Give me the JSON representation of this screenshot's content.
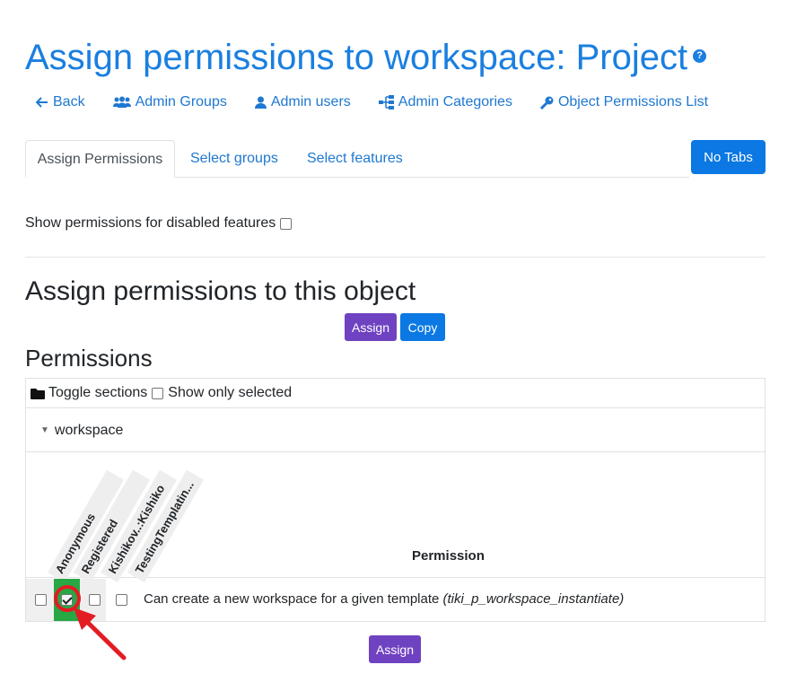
{
  "page": {
    "title": "Assign permissions to workspace: Project",
    "help_glyph": "?"
  },
  "nav": [
    {
      "label": "Back",
      "icon": "arrow-left-icon"
    },
    {
      "label": "Admin Groups",
      "icon": "users-icon"
    },
    {
      "label": "Admin users",
      "icon": "user-icon"
    },
    {
      "label": "Admin Categories",
      "icon": "sitemap-icon"
    },
    {
      "label": "Object Permissions List",
      "icon": "key-icon"
    }
  ],
  "tabs": [
    {
      "label": "Assign Permissions",
      "active": true
    },
    {
      "label": "Select groups",
      "active": false
    },
    {
      "label": "Select features",
      "active": false
    }
  ],
  "no_tabs_label": "No Tabs",
  "show_disabled_label": "Show permissions for disabled features",
  "section_heading": "Assign permissions to this object",
  "buttons": {
    "assign": "Assign",
    "copy": "Copy"
  },
  "permissions_heading": "Permissions",
  "table": {
    "toggle_sections": "Toggle sections",
    "show_only_selected": "Show only selected",
    "section_name": "workspace",
    "groups": [
      "Anonymous",
      "Registered",
      "Kishikov..:Kishiko",
      "TestingTemplatin..."
    ],
    "permission_header": "Permission",
    "rows": [
      {
        "description": "Can create a new workspace for a given template",
        "code": "(tiki_p_workspace_instantiate)",
        "checked": [
          false,
          true,
          false,
          false
        ]
      }
    ]
  },
  "colors": {
    "title": "#1a7fe0",
    "link": "#1f78d1",
    "primary_button": "#0b78e3",
    "assign_button": "#6f42c1",
    "checked_cell": "#28a745",
    "annotation": "#e31b23"
  }
}
